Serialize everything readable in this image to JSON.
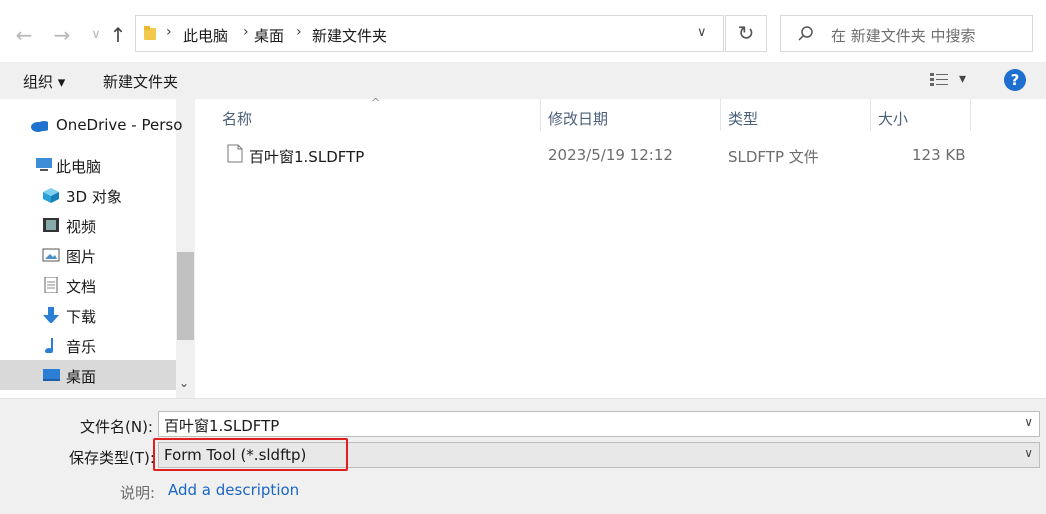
{
  "nav": {
    "back": "←",
    "forward": "→",
    "recent": "∨",
    "up": "↑"
  },
  "address": {
    "crumbs": [
      "此电脑",
      "桌面",
      "新建文件夹"
    ],
    "dropdown": "∨"
  },
  "refresh": "↻",
  "search": {
    "placeholder": "在 新建文件夹 中搜索"
  },
  "commandbar": {
    "organize": "组织 ▾",
    "new_folder": "新建文件夹",
    "view": "▾",
    "help": "?"
  },
  "sidebar": {
    "items": [
      {
        "label": "OneDrive - Perso",
        "icon": "cloud-icon"
      },
      {
        "label": "此电脑",
        "icon": "computer-icon"
      },
      {
        "label": "3D 对象",
        "icon": "cube-icon"
      },
      {
        "label": "视频",
        "icon": "video-icon"
      },
      {
        "label": "图片",
        "icon": "picture-icon"
      },
      {
        "label": "文档",
        "icon": "document-icon"
      },
      {
        "label": "下载",
        "icon": "download-icon"
      },
      {
        "label": "音乐",
        "icon": "music-icon"
      },
      {
        "label": "桌面",
        "icon": "desktop-icon",
        "selected": true
      }
    ]
  },
  "columns": [
    "名称",
    "修改日期",
    "类型",
    "大小"
  ],
  "files": [
    {
      "name": "百叶窗1.SLDFTP",
      "modified": "2023/5/19 12:12",
      "type": "SLDFTP 文件",
      "size": "123 KB"
    }
  ],
  "form": {
    "filename_label": "文件名(N):",
    "filename_value": "百叶窗1.SLDFTP",
    "savetype_label": "保存类型(T):",
    "savetype_value": "Form Tool (*.sldftp)",
    "desc_label": "说明:",
    "desc_link": "Add a description"
  },
  "colors": {
    "accent": "#1e6fd0",
    "highlight_box": "#e02020",
    "selected_bg": "#cce4f7"
  }
}
